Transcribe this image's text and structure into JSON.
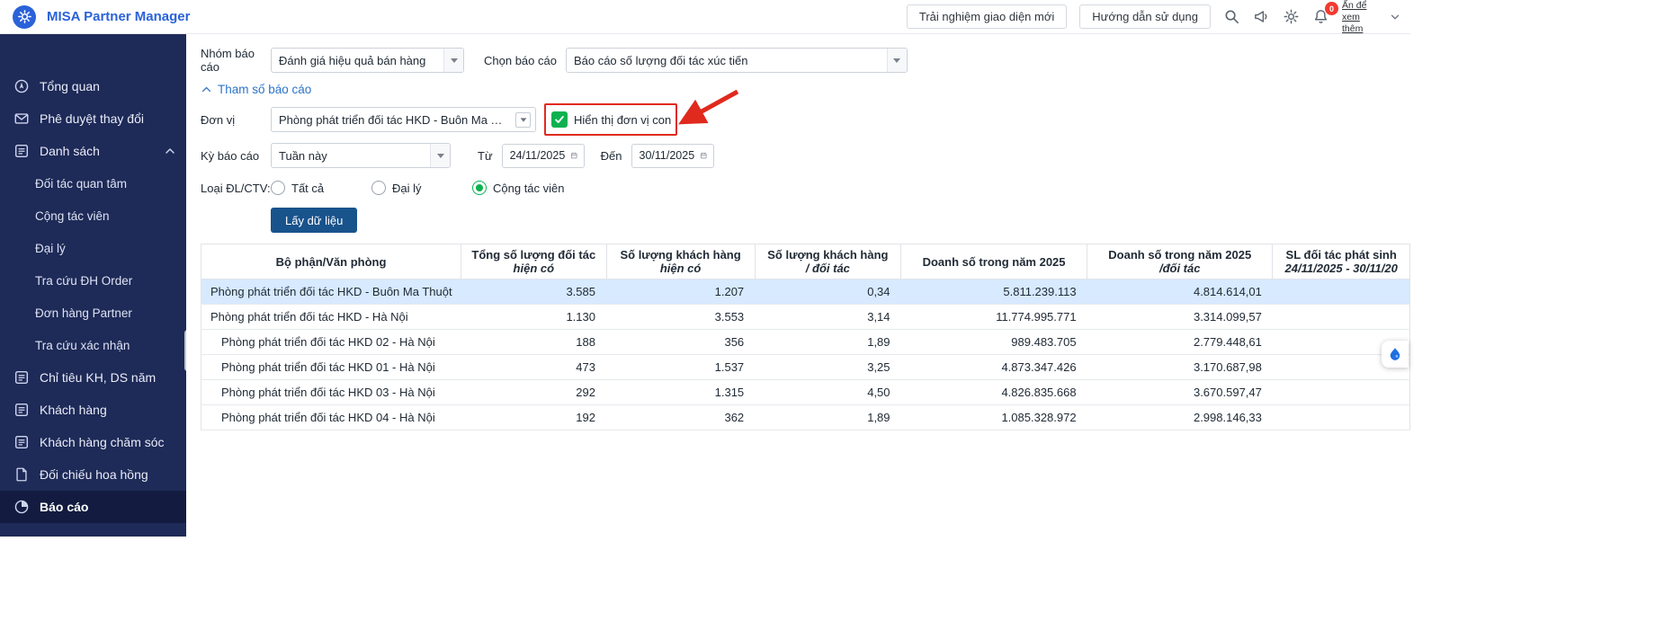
{
  "header": {
    "title": "MISA Partner Manager",
    "new_ui_button": "Trải nghiệm giao diện mới",
    "guide_button": "Hướng dẫn sử dụng",
    "notification_badge": "0",
    "avatar_alt": "Ấn để xem thêm"
  },
  "sidebar": {
    "items": [
      {
        "label": "Tổng quan",
        "icon": "overview-icon"
      },
      {
        "label": "Phê duyệt thay đổi",
        "icon": "envelope-icon"
      },
      {
        "label": "Danh sách",
        "icon": "list-icon",
        "expanded": true,
        "children": [
          "Đối tác quan tâm",
          "Cộng tác viên",
          "Đại lý",
          "Tra cứu ĐH Order",
          "Đơn hàng Partner",
          "Tra cứu xác nhận"
        ]
      },
      {
        "label": "Chỉ tiêu KH, DS năm",
        "icon": "list-icon"
      },
      {
        "label": "Khách hàng",
        "icon": "list-icon"
      },
      {
        "label": "Khách hàng chăm sóc",
        "icon": "list-icon"
      },
      {
        "label": "Đối chiếu hoa hồng",
        "icon": "doc-icon"
      },
      {
        "label": "Báo cáo",
        "icon": "report-icon",
        "active": true
      }
    ]
  },
  "filters": {
    "report_group": {
      "label": "Nhóm báo cáo",
      "value": "Đánh giá hiệu quả bán hàng"
    },
    "report_name": {
      "label": "Chọn báo cáo",
      "value": "Báo cáo số lượng đối tác xúc tiến"
    },
    "params_toggle": "Tham số báo cáo",
    "unit": {
      "label": "Đơn vị",
      "value": "Phòng phát triển đối tác HKD - Buôn Ma Thuột, Phòng"
    },
    "show_children": {
      "label": "Hiển thị đơn vị con",
      "checked": true
    },
    "period": {
      "label": "Kỳ báo cáo",
      "value": "Tuần này"
    },
    "from": {
      "label": "Từ",
      "value": "24/11/2025"
    },
    "to": {
      "label": "Đến",
      "value": "30/11/2025"
    },
    "partner_type": {
      "label": "Loại ĐL/CTV:",
      "options": [
        "Tất cả",
        "Đại lý",
        "Cộng tác viên"
      ],
      "selected": "Cộng tác viên"
    },
    "get_data_button": "Lấy dữ liệu"
  },
  "table": {
    "headers": [
      {
        "line1": "Bộ phận/Văn phòng",
        "line2": ""
      },
      {
        "line1": "Tổng số lượng đối tác",
        "line2": "hiện có"
      },
      {
        "line1": "Số lượng khách hàng",
        "line2": "hiện có"
      },
      {
        "line1": "Số lượng khách hàng",
        "line2": "/ đối tác"
      },
      {
        "line1": "Doanh số trong năm 2025",
        "line2": ""
      },
      {
        "line1": "Doanh số trong năm 2025",
        "line2": "/đối tác"
      },
      {
        "line1": "SL đối tác phát sinh",
        "line2": "24/11/2025 - 30/11/20"
      }
    ],
    "rows": [
      {
        "name": "Phòng phát triển đối tác HKD - Buôn Ma Thuột",
        "indent": false,
        "highlighted": true,
        "values": [
          "3.585",
          "1.207",
          "0,34",
          "5.811.239.113",
          "4.814.614,01",
          ""
        ]
      },
      {
        "name": "Phòng phát triển đối tác HKD - Hà Nội",
        "indent": false,
        "values": [
          "1.130",
          "3.553",
          "3,14",
          "11.774.995.771",
          "3.314.099,57",
          ""
        ]
      },
      {
        "name": "Phòng phát triển đối tác HKD 02 - Hà Nội",
        "indent": true,
        "values": [
          "188",
          "356",
          "1,89",
          "989.483.705",
          "2.779.448,61",
          ""
        ]
      },
      {
        "name": "Phòng phát triển đối tác HKD 01 - Hà Nội",
        "indent": true,
        "values": [
          "473",
          "1.537",
          "3,25",
          "4.873.347.426",
          "3.170.687,98",
          ""
        ]
      },
      {
        "name": "Phòng phát triển đối tác HKD 03 - Hà Nội",
        "indent": true,
        "values": [
          "292",
          "1.315",
          "4,50",
          "4.826.835.668",
          "3.670.597,47",
          ""
        ]
      },
      {
        "name": "Phòng phát triển đối tác HKD 04 - Hà Nội",
        "indent": true,
        "values": [
          "192",
          "362",
          "1,89",
          "1.085.328.972",
          "2.998.146,33",
          ""
        ]
      }
    ]
  },
  "colors": {
    "sidebar_bg": "#1e2a57",
    "sidebar_active_bg": "#131c40",
    "accent_blue": "#2a62d9",
    "primary_button": "#19538c",
    "success_green": "#0db14f",
    "annotation_red": "#e02a1e",
    "highlight_row": "#d7eaff",
    "badge_red": "#f23a30"
  }
}
